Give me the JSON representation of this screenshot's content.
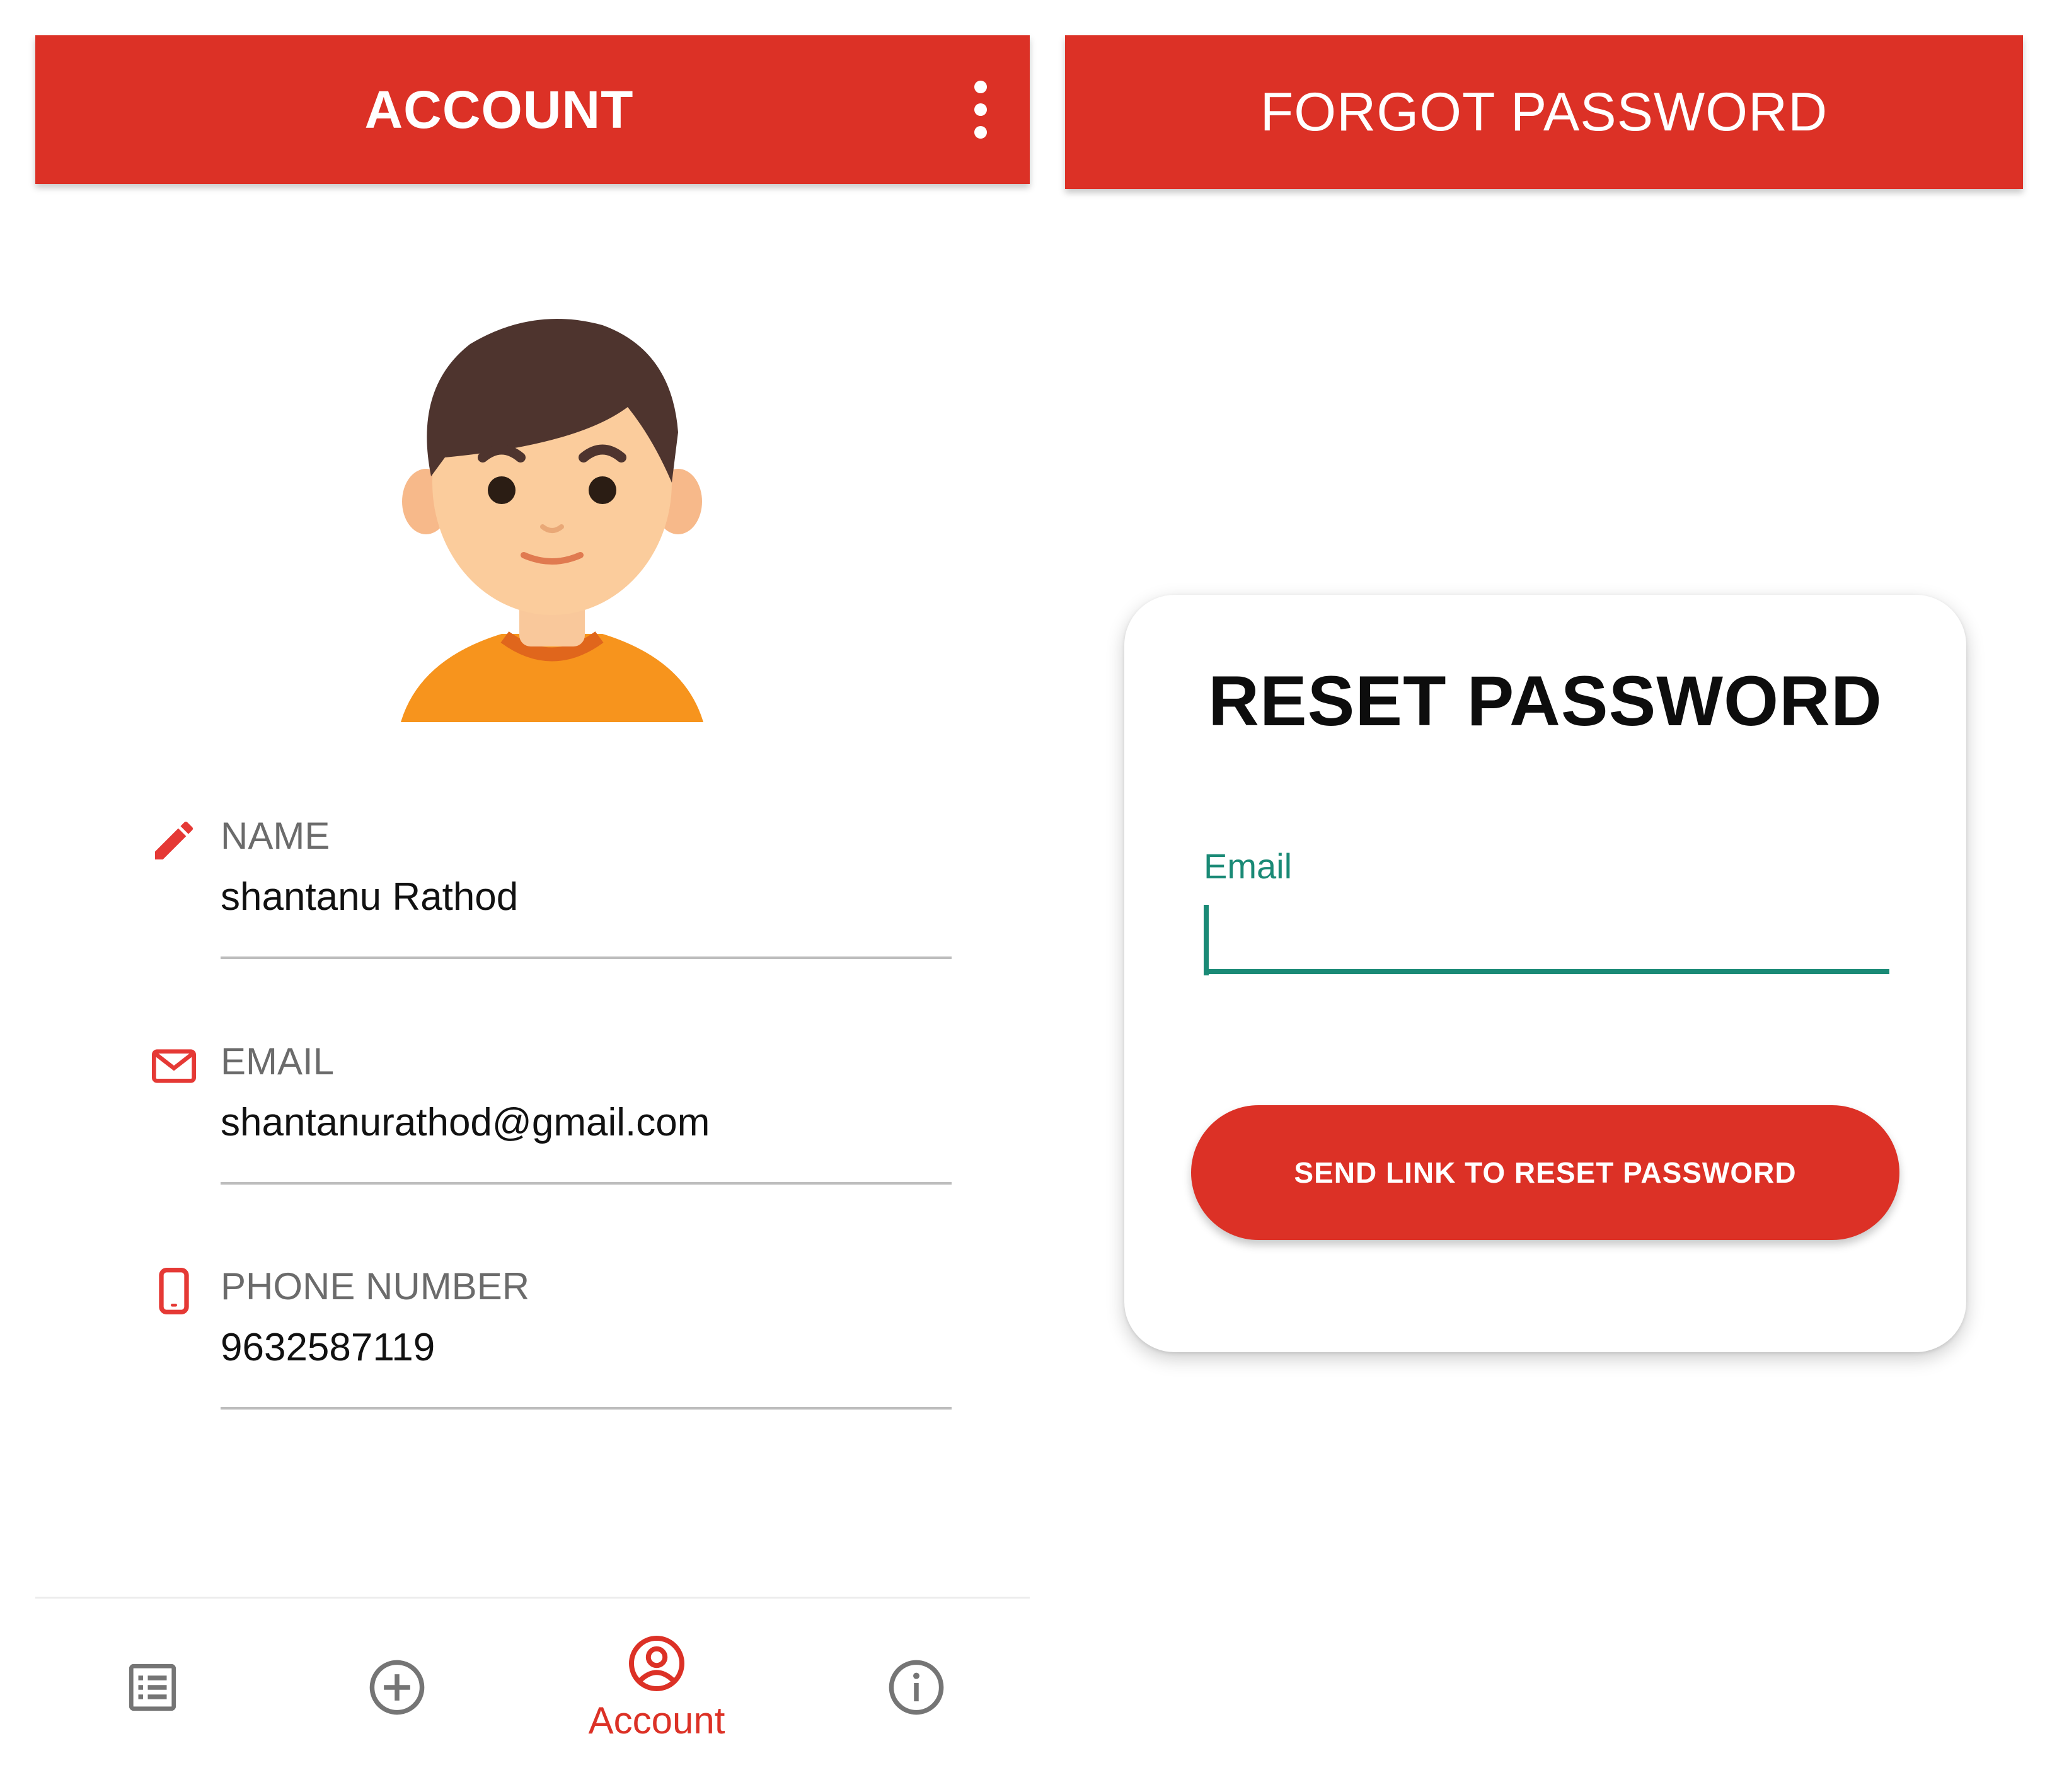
{
  "account_screen": {
    "appbar": {
      "title": "ACCOUNT",
      "menu_icon": "more-vertical-icon"
    },
    "avatar": {
      "description_icon": "boy-avatar"
    },
    "fields": {
      "name": {
        "icon": "pencil-icon",
        "label": "NAME",
        "value": "shantanu Rathod"
      },
      "email": {
        "icon": "mail-icon",
        "label": "EMAIL",
        "value": "shantanurathod@gmail.com"
      },
      "phone": {
        "icon": "phone-icon",
        "label": "PHONE NUMBER",
        "value": "9632587119"
      }
    },
    "bottom_nav": {
      "items": [
        {
          "icon": "list-icon",
          "label": ""
        },
        {
          "icon": "add-circle-icon",
          "label": ""
        },
        {
          "icon": "account-circle-icon",
          "label": "Account",
          "active": true
        },
        {
          "icon": "info-icon",
          "label": ""
        }
      ]
    }
  },
  "forgot_password_screen": {
    "appbar": {
      "title": "FORGOT PASSWORD"
    },
    "card": {
      "title": "RESET PASSWORD",
      "email_label": "Email",
      "email_value": "",
      "button_label": "SEND LINK TO RESET PASSWORD"
    }
  },
  "colors": {
    "primary_red": "#dc3126",
    "accent_teal": "#1a8a76",
    "label_gray": "#6b6b6b",
    "divider_gray": "#bdbdbd"
  }
}
